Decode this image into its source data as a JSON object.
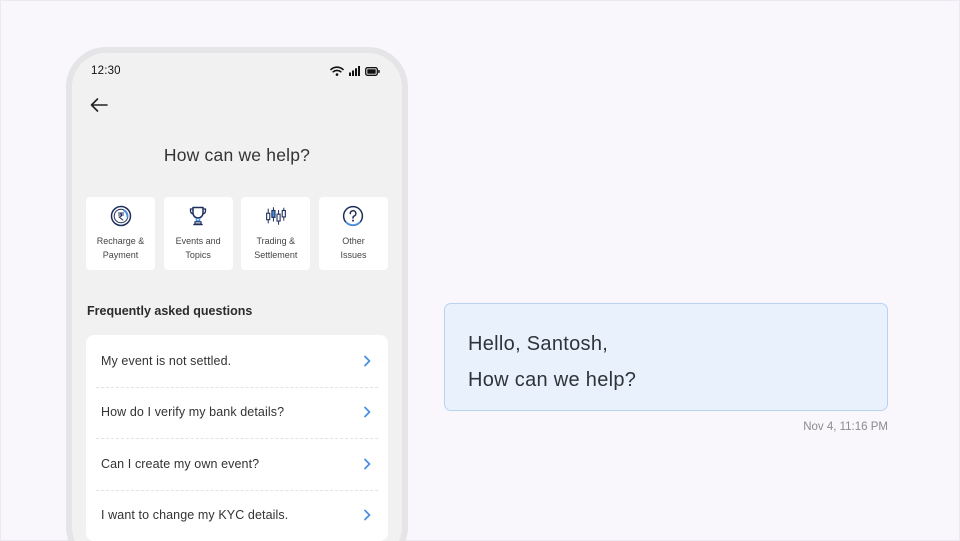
{
  "status": {
    "time": "12:30",
    "icons": [
      "wifi-icon",
      "signal-icon",
      "battery-icon"
    ]
  },
  "nav": {
    "back_icon": "arrow-left-icon"
  },
  "help_title": "How can we help?",
  "categories": [
    {
      "label": "Recharge &\nPayment",
      "icon": "rupee-coin-icon"
    },
    {
      "label": "Events and\nTopics",
      "icon": "trophy-icon"
    },
    {
      "label": "Trading &\nSettlement",
      "icon": "candlestick-chart-icon"
    },
    {
      "label": "Other\nIssues",
      "icon": "question-circle-icon"
    }
  ],
  "faq": {
    "title": "Frequently asked questions",
    "items": [
      "My event is not settled.",
      "How do I verify my bank details?",
      "Can I create my own event?",
      "I want to change my KYC details."
    ],
    "chevron_icon": "chevron-right-icon"
  },
  "chat": {
    "greeting": "Hello, Santosh,",
    "message": "How can we help?",
    "timestamp": "Nov 4, 11:16 PM"
  },
  "colors": {
    "accent": "#4a90e2",
    "bubble_bg": "#e8f1fc",
    "bubble_border": "#b9d2f2",
    "icon_navy": "#1f2f5c"
  }
}
